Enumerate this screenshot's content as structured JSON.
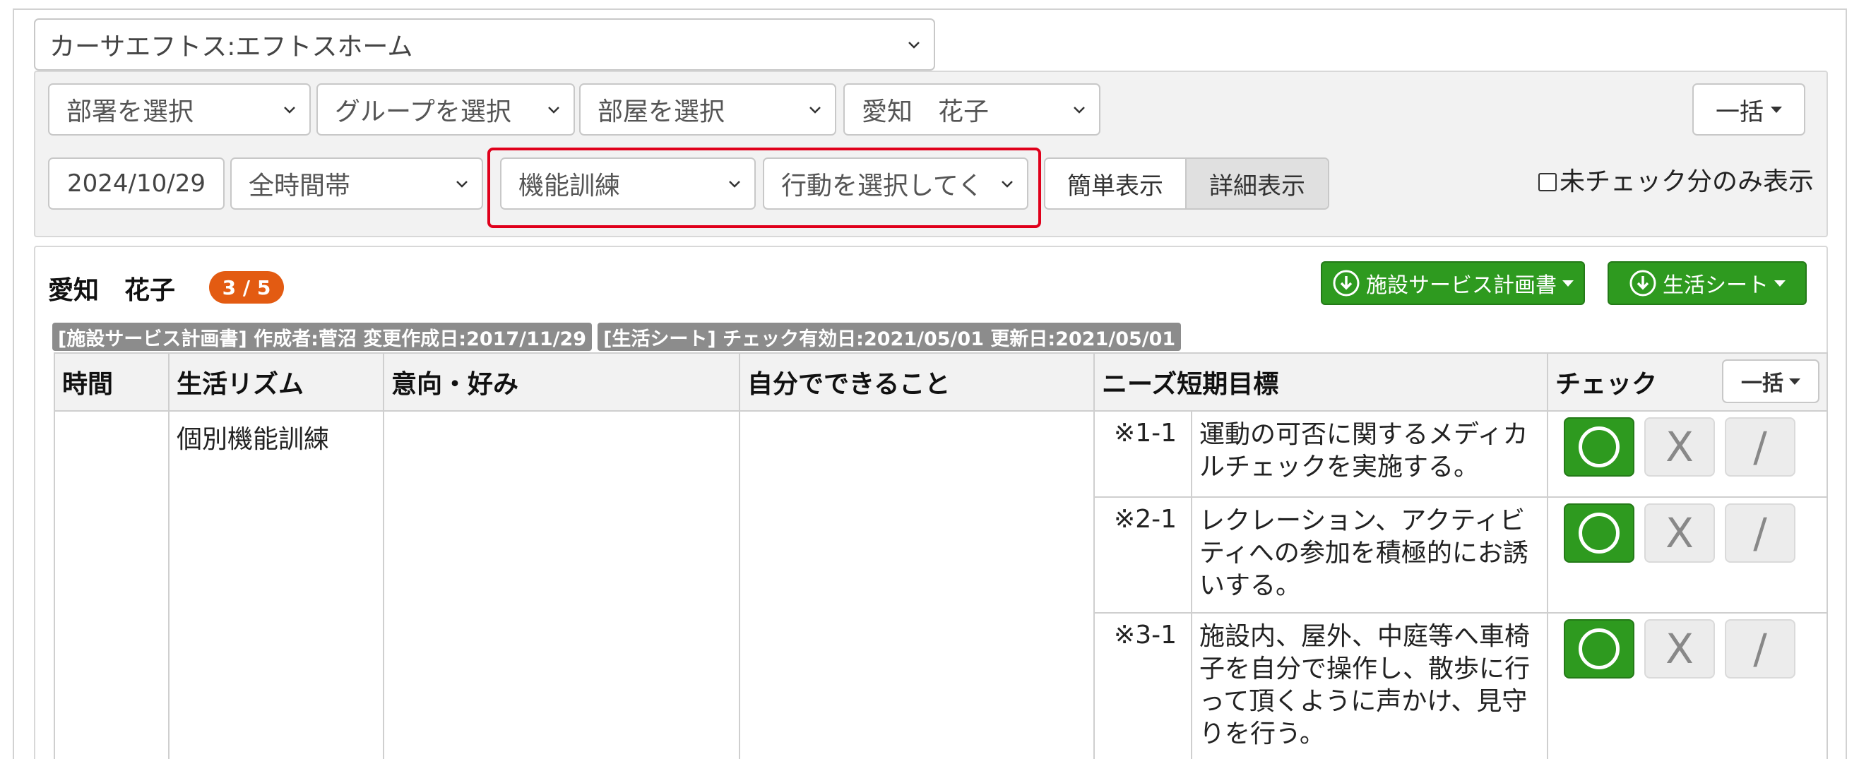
{
  "facility_select": {
    "value": "カーサエフトス:エフトスホーム",
    "icon": "chevron-down-icon"
  },
  "filters": {
    "department": "部署を選択",
    "group": "グループを選択",
    "room": "部屋を選択",
    "resident": "愛知　花子",
    "bulk_label": "一括",
    "date": "2024/10/29",
    "time_range": "全時間帯",
    "category": "機能訓練",
    "action": "行動を選択してく",
    "view_simple": "簡単表示",
    "view_detail": "詳細表示",
    "unchecked_only": "未チェック分のみ表示"
  },
  "record": {
    "name": "愛知　花子",
    "progress": "3 / 5",
    "progress_badge_color": "#e35b12",
    "plan_button": "施設サービス計画書",
    "sheet_button": "生活シート",
    "button_color": "#2e9a1f",
    "meta_plan": "[施設サービス計画書]  作成者:菅沼  変更作成日:2017/11/29",
    "meta_sheet": "[生活シート]  チェック有効日:2021/05/01  更新日:2021/05/01"
  },
  "table": {
    "headers": {
      "time": "時間",
      "rhythm": "生活リズム",
      "intent": "意向・好み",
      "self": "自分でできること",
      "needs": "ニーズ短期目標",
      "check": "チェック",
      "bulk": "一括"
    },
    "rhythm": "個別機能訓練",
    "rows": [
      {
        "id": "※1-1",
        "text": "運動の可否に関するメディカルチェックを実施する。",
        "ok": "",
        "ng": "X",
        "na": "/"
      },
      {
        "id": "※2-1",
        "text": "レクレーション、アクティビティへの参加を積極的にお誘いする。",
        "ok": "",
        "ng": "X",
        "na": "/"
      },
      {
        "id": "※3-1",
        "text": "施設内、屋外、中庭等へ車椅子を自分で操作し、散歩に行って頂くように声かけ、見守りを行う。",
        "ok": "",
        "ng": "X",
        "na": "/"
      }
    ]
  }
}
